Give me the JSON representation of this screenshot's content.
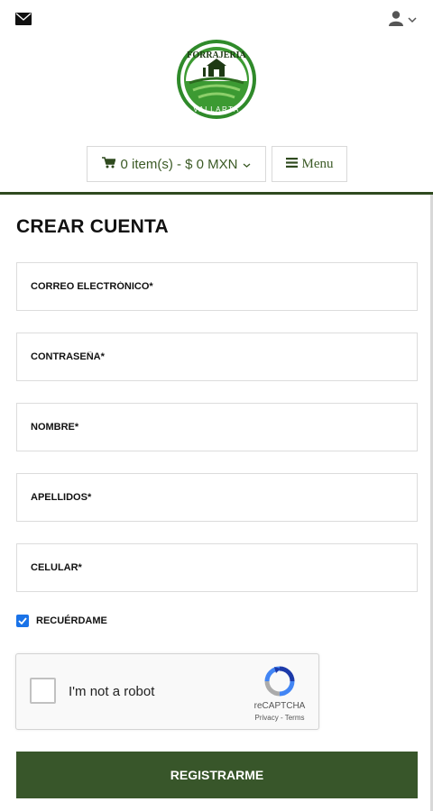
{
  "header": {
    "mail_icon": "envelope-icon",
    "user_icon": "user-icon",
    "logo_text_top": "FORRAJERIA",
    "logo_text_bottom": "VALLARTA",
    "cart_label": "0 item(s) - $ 0 MXN",
    "menu_label": "Menu"
  },
  "colors": {
    "brand_green": "#38562a",
    "link_green": "#3b5a25",
    "checkbox_blue": "#1a73e8"
  },
  "form": {
    "title": "CREAR CUENTA",
    "fields": [
      {
        "placeholder": "CORREO ELECTRÓNICO*",
        "value": ""
      },
      {
        "placeholder": "CONTRASEÑA*",
        "value": ""
      },
      {
        "placeholder": "NOMBRE*",
        "value": ""
      },
      {
        "placeholder": "APELLIDOS*",
        "value": ""
      },
      {
        "placeholder": "CELULAR*",
        "value": ""
      }
    ],
    "remember_label": "RECUÉRDAME",
    "remember_checked": true,
    "submit_label": "REGISTRARME"
  },
  "recaptcha": {
    "label": "I'm not a robot",
    "brand": "reCAPTCHA",
    "privacy": "Privacy",
    "separator": " - ",
    "terms": "Terms"
  }
}
